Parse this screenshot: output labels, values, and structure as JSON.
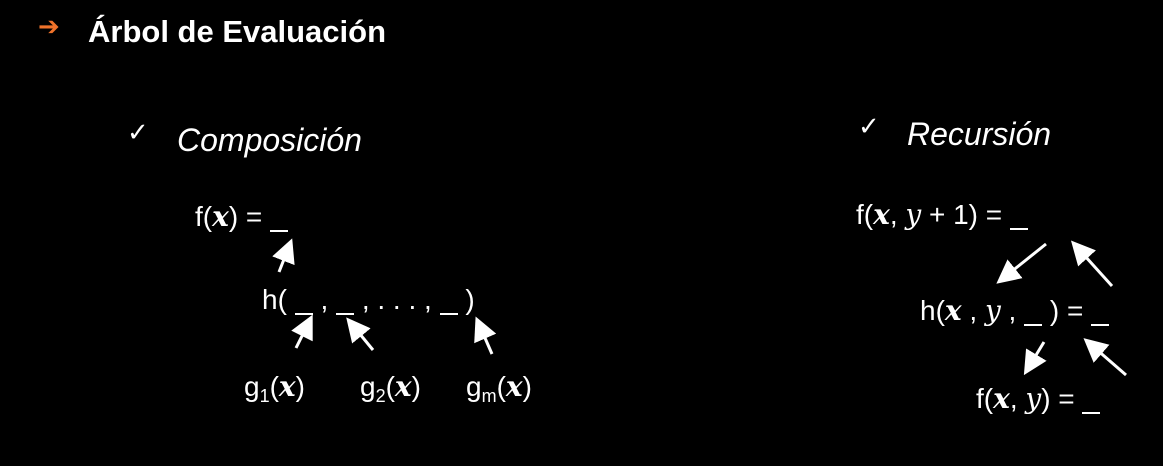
{
  "header": {
    "title": "Árbol de Evaluación",
    "bullet_color": "#f0722a"
  },
  "left": {
    "subtitle": "Composición",
    "root": {
      "prefix": "f(",
      "var": "x",
      "suffix": ") = "
    },
    "h": {
      "open": "h(",
      "sep": ",",
      "dots": ", . . . ,",
      "close": ")"
    },
    "leaves": [
      {
        "name": "g",
        "sub": "1",
        "var": "x"
      },
      {
        "name": "g",
        "sub": "2",
        "var": "x"
      },
      {
        "name": "g",
        "sub": "m",
        "var": "x"
      }
    ]
  },
  "right": {
    "subtitle": "Recursión",
    "root": {
      "prefix": "f(",
      "var_x": "x",
      "comma": ", ",
      "var_y": "y",
      "suffix": " + 1) = "
    },
    "h": {
      "prefix": "h(",
      "var_x": "x",
      "comma": " , ",
      "var_y": "y",
      "comma2": " , ",
      "suffix": " ) = "
    },
    "f": {
      "prefix": "f(",
      "var_x": "x",
      "comma": ", ",
      "var_y": "y",
      "suffix": ") =  "
    }
  }
}
